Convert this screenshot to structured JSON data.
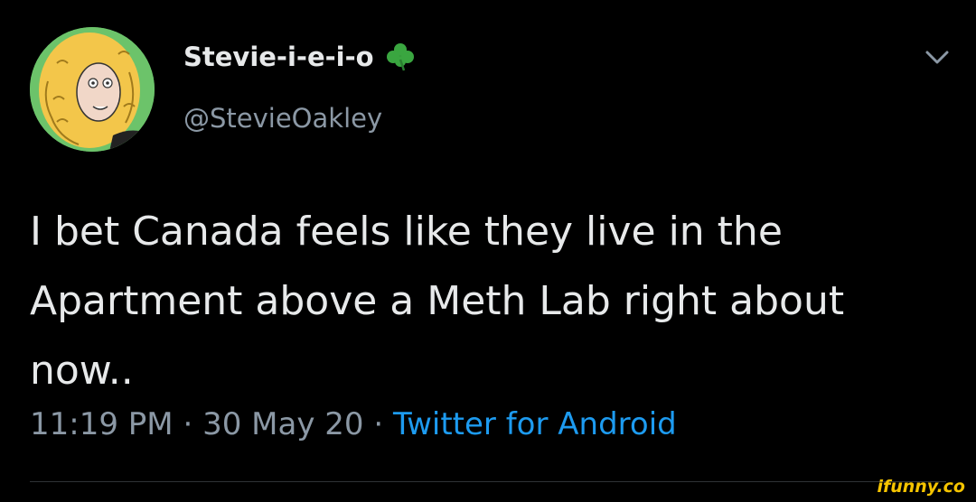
{
  "tweet": {
    "display_name": "Stevie-i-e-i-o",
    "handle": "@StevieOakley",
    "text": "I bet Canada feels like they live in the Apartment above a Meth Lab right about now..",
    "time": "11:19 PM",
    "separator": "·",
    "date": "30 May 20",
    "source": "Twitter for Android",
    "name_emoji": "shamrock-icon",
    "menu_icon": "chevron-down-icon"
  },
  "watermark": "ifunny.co",
  "colors": {
    "background": "#000000",
    "text": "#e7e9ea",
    "secondary": "#8b98a5",
    "link": "#1d9bf0",
    "avatar_bg": "#6cc36a",
    "clover": "#3aa640",
    "watermark": "#f5c400"
  }
}
